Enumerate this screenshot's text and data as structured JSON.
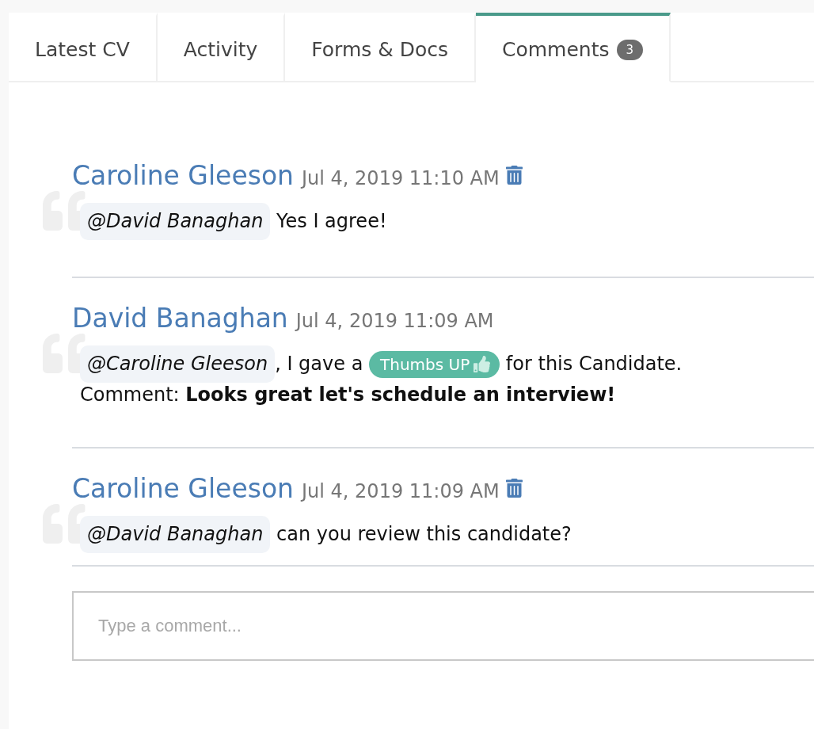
{
  "tabs": [
    {
      "label": "Latest CV",
      "selected": false
    },
    {
      "label": "Activity",
      "selected": false
    },
    {
      "label": "Forms & Docs",
      "selected": false
    },
    {
      "label": "Comments",
      "selected": true,
      "badge": "3"
    }
  ],
  "comments": [
    {
      "author": "Caroline Gleeson",
      "timestamp": "Jul 4, 2019 11:10 AM",
      "deletable": true,
      "lines": [
        [
          {
            "kind": "mention",
            "text": "@David Banaghan"
          },
          {
            "kind": "text",
            "text": " Yes I agree!"
          }
        ]
      ]
    },
    {
      "author": "David Banaghan",
      "timestamp": "Jul 4, 2019 11:09 AM",
      "deletable": false,
      "lines": [
        [
          {
            "kind": "mention",
            "text": "@Caroline Gleeson"
          },
          {
            "kind": "text",
            "text": ", I gave a "
          },
          {
            "kind": "rating",
            "text": "Thumbs UP"
          },
          {
            "kind": "text",
            "text": " for this Candidate."
          }
        ],
        [
          {
            "kind": "text",
            "text": "Comment: **Looks great let's schedule an interview!**"
          }
        ]
      ]
    },
    {
      "author": "Caroline Gleeson",
      "timestamp": "Jul 4, 2019 11:09 AM",
      "deletable": true,
      "lines": [
        [
          {
            "kind": "mention",
            "text": "@David Banaghan"
          },
          {
            "kind": "text",
            "text": " can you review this candidate?"
          }
        ]
      ]
    }
  ],
  "comment_box": {
    "placeholder": "Type a comment..."
  }
}
